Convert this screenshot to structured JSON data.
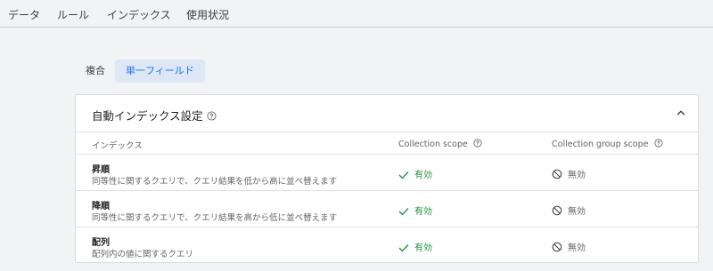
{
  "nav": {
    "tabs": [
      "データ",
      "ルール",
      "インデックス",
      "使用状況"
    ]
  },
  "subtabs": [
    "複合",
    "単一フィールド"
  ],
  "panel": {
    "title": "自動インデックス設定",
    "columns": [
      "インデックス",
      "Collection scope",
      "Collection group scope"
    ],
    "rows": [
      {
        "title": "昇順",
        "desc": "同等性に関するクエリで、クエリ結果を低から高に並べ替えます",
        "collection": "有効",
        "group": "無効"
      },
      {
        "title": "降順",
        "desc": "同等性に関するクエリで、クエリ結果を高から低に並べ替えます",
        "collection": "有効",
        "group": "無効"
      },
      {
        "title": "配列",
        "desc": "配列内の値に関するクエリ",
        "collection": "有効",
        "group": "無効"
      }
    ]
  },
  "colors": {
    "accent": "#1a73e8",
    "enabled": "#1e8e3e",
    "tab_active_bg": "#dde7f6"
  }
}
